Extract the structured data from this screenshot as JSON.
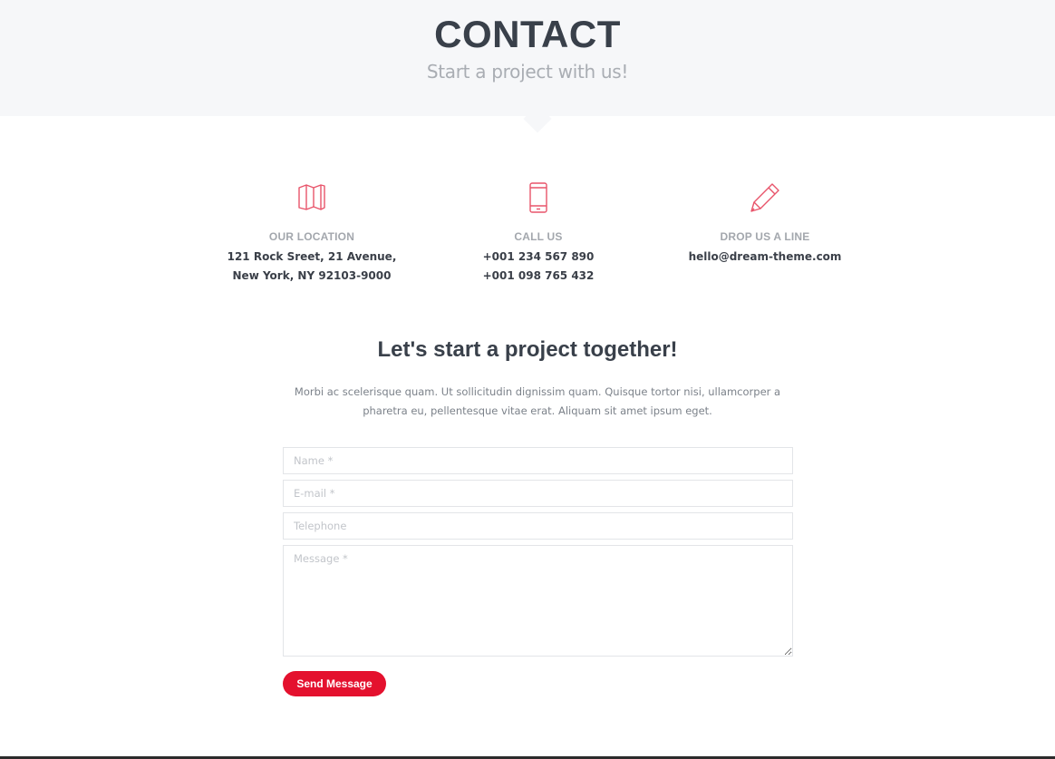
{
  "hero": {
    "title": "CONTACT",
    "subtitle": "Start a project with us!"
  },
  "info": [
    {
      "icon": "map-icon",
      "label": "OUR LOCATION",
      "lines": [
        "121 Rock Sreet, 21 Avenue,",
        "New York, NY 92103-9000"
      ]
    },
    {
      "icon": "phone-icon",
      "label": "CALL US",
      "lines": [
        "+001 234 567 890",
        "+001 098 765 432"
      ]
    },
    {
      "icon": "pencil-icon",
      "label": "DROP US A LINE",
      "lines": [
        "hello@dream-theme.com"
      ]
    }
  ],
  "form": {
    "title": "Let's start a project together!",
    "intro": "Morbi ac scelerisque quam. Ut sollicitudin dignissim quam. Quisque tortor nisi, ullamcorper a pharetra eu, pellentesque vitae erat. Aliquam sit amet ipsum eget.",
    "name_placeholder": "Name *",
    "email_placeholder": "E-mail *",
    "phone_placeholder": "Telephone",
    "message_placeholder": "Message *",
    "submit_label": "Send Message"
  },
  "colors": {
    "accent": "#e4112e",
    "icon": "#e8546a",
    "hero_bg": "#f6f7f9"
  }
}
